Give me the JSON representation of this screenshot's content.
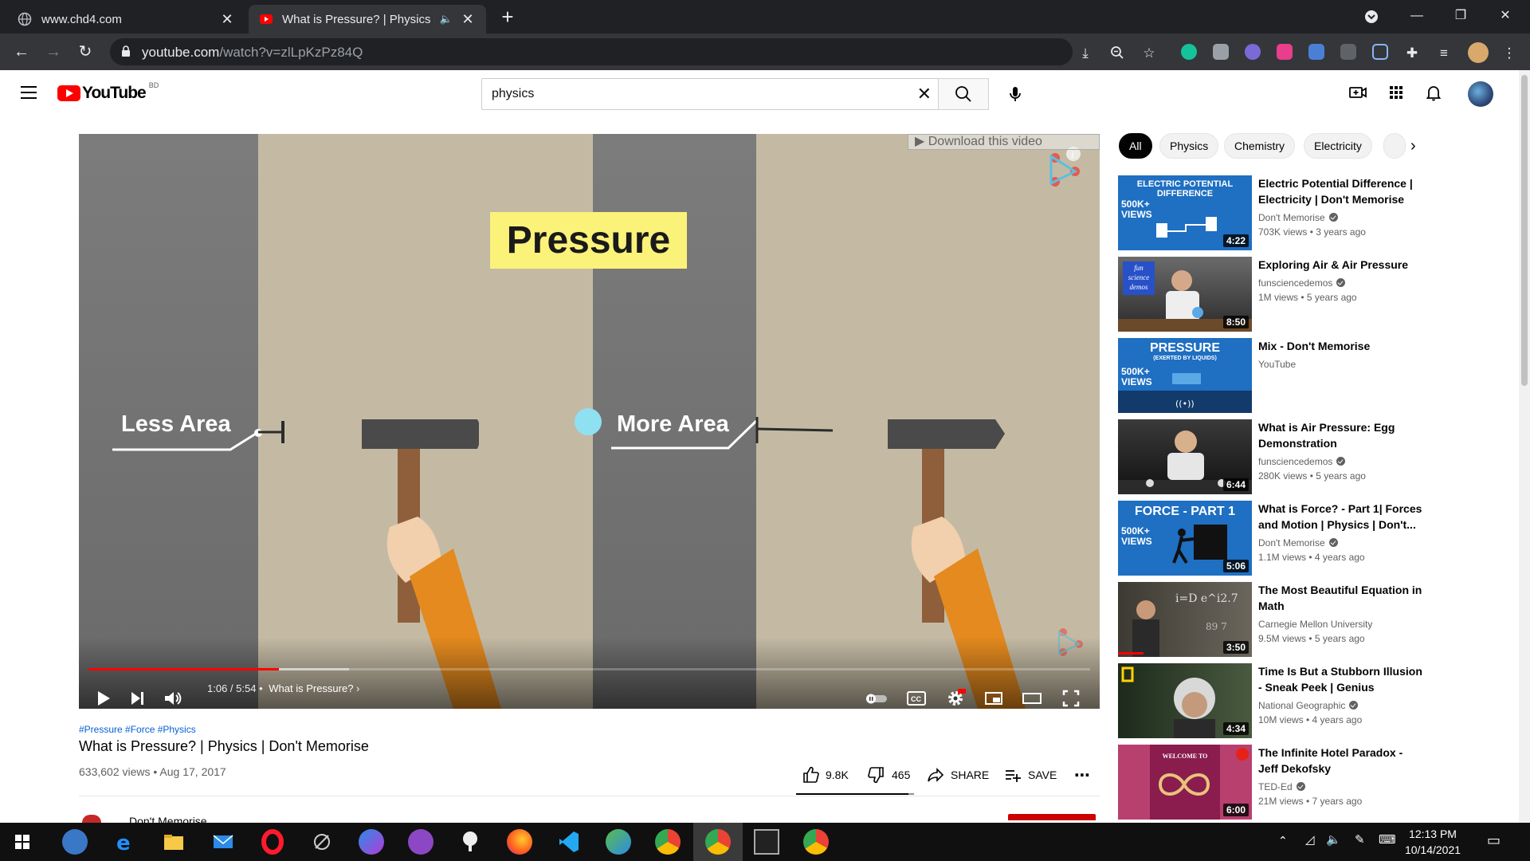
{
  "browser": {
    "tabs": [
      {
        "title": "www.chd4.com",
        "active": false
      },
      {
        "title": "What is Pressure? | Physics | Don't Memorise",
        "active": true
      }
    ],
    "url_host": "youtube.com",
    "url_path": "/watch?v=zlLpKzPz84Q"
  },
  "youtube": {
    "logo_text": "YouTube",
    "country_code": "BD",
    "search_value": "physics",
    "search_placeholder": "Search"
  },
  "player": {
    "overlay_title": "Pressure",
    "label_left": "Less Area",
    "label_right": "More Area",
    "download_banner": "Download this video",
    "time": "1:06 / 5:54",
    "chapter": "What is Pressure?",
    "progress_played": 0.19,
    "progress_buffered": 0.26
  },
  "video": {
    "tags": "#Pressure #Force #Physics",
    "title": "What is Pressure? | Physics | Don't Memorise",
    "meta": "633,602 views • Aug 17, 2017",
    "likes": "9.8K",
    "dislikes": "465",
    "share_label": "SHARE",
    "save_label": "SAVE",
    "channel_peek": "Don't Memorise",
    "like_ratio": 0.95
  },
  "chips": [
    "All",
    "Physics",
    "Chemistry",
    "Electricity"
  ],
  "recommendations": [
    {
      "title": "Electric Potential Difference | Electricity | Don't Memorise",
      "channel": "Don't Memorise",
      "verified": true,
      "meta": "703K views • 3 years ago",
      "duration": "4:22",
      "thumb_text": "ELECTRIC POTENTIAL DIFFERENCE",
      "badge": "500K+ VIEWS"
    },
    {
      "title": "Exploring Air & Air Pressure",
      "channel": "funsciencedemos",
      "verified": true,
      "meta": "1M views • 5 years ago",
      "duration": "8:50",
      "thumb_text": "fun science demos",
      "badge": ""
    },
    {
      "title": "Mix - Don't Memorise",
      "channel": "YouTube",
      "verified": false,
      "meta": "",
      "duration": "",
      "thumb_text": "PRESSURE",
      "thumb_sub": "(EXERTED BY LIQUIDS)",
      "badge": "500K+ VIEWS"
    },
    {
      "title": "What is Air Pressure: Egg Demonstration",
      "channel": "funsciencedemos",
      "verified": true,
      "meta": "280K views • 5 years ago",
      "duration": "6:44",
      "thumb_text": "",
      "badge": ""
    },
    {
      "title": "What is Force? - Part 1| Forces and Motion | Physics | Don't...",
      "channel": "Don't Memorise",
      "verified": true,
      "meta": "1.1M views • 4 years ago",
      "duration": "5:06",
      "thumb_text": "FORCE - PART 1",
      "badge": "500K+ VIEWS"
    },
    {
      "title": "The Most Beautiful Equation in Math",
      "channel": "Carnegie Mellon University",
      "verified": false,
      "meta": "9.5M views • 5 years ago",
      "duration": "3:50",
      "thumb_text": "",
      "badge": ""
    },
    {
      "title": "Time Is But a Stubborn Illusion - Sneak Peek | Genius",
      "channel": "National Geographic",
      "verified": true,
      "meta": "10M views • 4 years ago",
      "duration": "4:34",
      "thumb_text": "",
      "badge": ""
    },
    {
      "title": "The Infinite Hotel Paradox - Jeff Dekofsky",
      "channel": "TED-Ed",
      "verified": true,
      "meta": "21M views • 7 years ago",
      "duration": "6:00",
      "thumb_text": "WELCOME TO",
      "badge": ""
    }
  ],
  "taskbar": {
    "time": "12:13 PM",
    "date": "10/14/2021"
  },
  "colors": {
    "youtube_red": "#ff0000",
    "chrome_dark": "#202124",
    "chrome_toolbar": "#35363a",
    "link_blue": "#065fd4",
    "pressure_yellow": "#fbf27a"
  }
}
